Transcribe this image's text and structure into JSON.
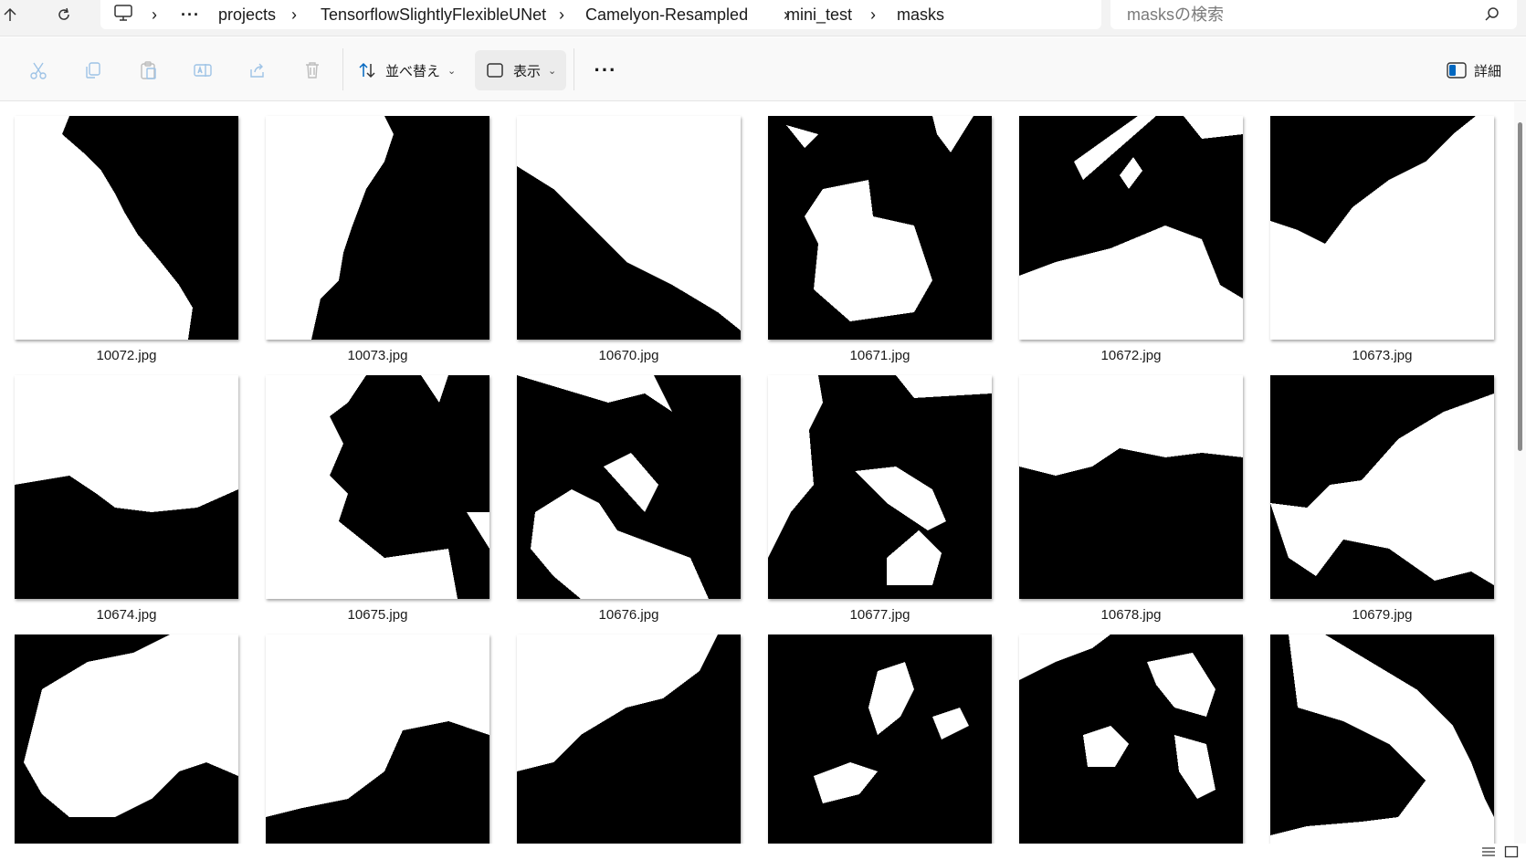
{
  "addressbar": {
    "breadcrumbs": [
      "projects",
      "TensorflowSlightlyFlexibleUNet",
      "Camelyon-Resampled",
      "mini_test",
      "masks"
    ],
    "overflow": "···",
    "search_placeholder": "masksの検索"
  },
  "toolbar": {
    "sort_label": "並べ替え",
    "view_label": "表示",
    "more": "···",
    "details_label": "詳細",
    "icons": [
      "cut-icon",
      "copy-icon",
      "paste-icon",
      "rename-icon",
      "share-icon",
      "delete-icon"
    ]
  },
  "files": [
    {
      "name": "10072.jpg"
    },
    {
      "name": "10073.jpg"
    },
    {
      "name": "10670.jpg"
    },
    {
      "name": "10671.jpg"
    },
    {
      "name": "10672.jpg"
    },
    {
      "name": "10673.jpg"
    },
    {
      "name": "10674.jpg"
    },
    {
      "name": "10675.jpg"
    },
    {
      "name": "10676.jpg"
    },
    {
      "name": "10677.jpg"
    },
    {
      "name": "10678.jpg"
    },
    {
      "name": "10679.jpg"
    },
    {
      "name": ""
    },
    {
      "name": ""
    },
    {
      "name": ""
    },
    {
      "name": ""
    },
    {
      "name": ""
    },
    {
      "name": ""
    }
  ],
  "colors": {
    "window_bg": "#f3f3f3",
    "toolbar_bg": "#f9f9f9",
    "accent": "#0067c0",
    "mask_fg": "#ffffff",
    "mask_bg": "#000000"
  }
}
